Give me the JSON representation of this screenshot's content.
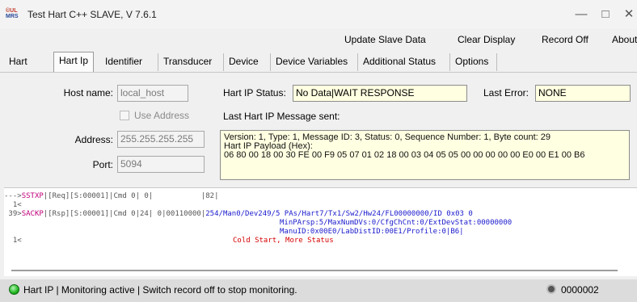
{
  "window": {
    "title": "Test Hart C++ SLAVE, V 7.6.1",
    "logo_line1": "©UL",
    "logo_line2": "MRS",
    "minimize": "—",
    "maximize": "□",
    "close": "✕"
  },
  "commands": {
    "update_slave_data": "Update Slave Data",
    "clear_display": "Clear Display",
    "record_off": "Record Off",
    "about": "About"
  },
  "tabs": [
    "Hart",
    "Hart Ip",
    "Identifier",
    "Transducer",
    "Device",
    "Device Variables",
    "Additional Status",
    "Options"
  ],
  "form": {
    "host_name_label": "Host name:",
    "host_name_value": "local_host",
    "use_address_label": "Use Address",
    "address_label": "Address:",
    "address_value": "255.255.255.255",
    "port_label": "Port:",
    "port_value": "5094",
    "hart_ip_status_label": "Hart IP Status:",
    "hart_ip_status_value": "No Data|WAIT RESPONSE",
    "last_error_label": "Last Error:",
    "last_error_value": "NONE",
    "last_msg_label": "Last Hart IP Message sent:",
    "msg_line1": "Version: 1, Type: 1, Message ID: 3, Status: 0, Sequence Number: 1,  Byte count: 29",
    "msg_line2": "Hart IP Payload (Hex):",
    "msg_line3": "06 80 00 18 00 30 FE 00 F9 05 07 01 02 18 00 03 04 05 05 00 00 00 00 00 E0 00 E1 00 B6"
  },
  "log": {
    "l1a": "--->",
    "l1b": "SSTXP",
    "l1c": "|[Req][S:00001]|Cmd 0| 0|           |82|",
    "l2": "  1<",
    "l3a": " 39>",
    "l3b": "SACKP",
    "l3c": "|[Rsp][S:00001]|Cmd 0|24| 0|00110000|",
    "l3d": "254/Man0/Dev249/5 PAs/Hart7/Tx1/Sw2/Hw24/FL00000000/ID 0x03 0",
    "l4": "MinPArsp:5/MaxNumDVs:0/CfgChCnt:0/ExtDevStat:00000000",
    "l5": "ManuID:0x00E0/LabDistID:00E1/Profile:0|B6|",
    "l6a": "  1<",
    "l6b": "Cold Start, More Status"
  },
  "status": {
    "text": "Hart IP  | Monitoring active | Switch record off to stop monitoring.",
    "counter": "0000002"
  }
}
